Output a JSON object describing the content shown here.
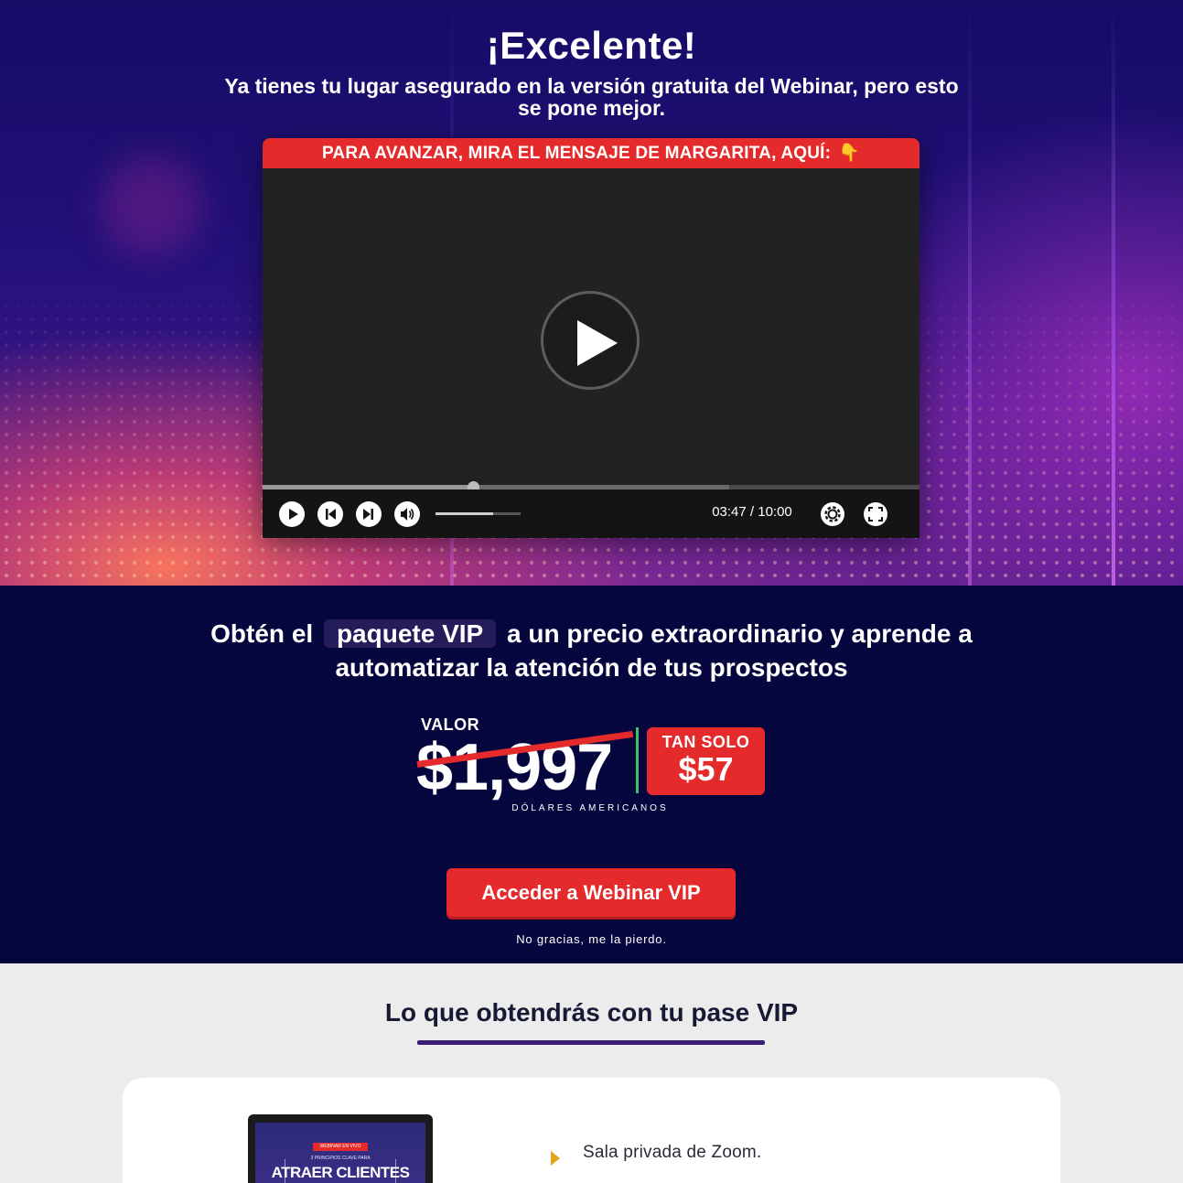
{
  "hero": {
    "title": "¡Excelente!",
    "subtitle": "Ya tienes tu lugar asegurado en la versión gratuita del Webinar, pero esto se pone mejor."
  },
  "video": {
    "banner_text": "PARA AVANZAR, MIRA EL MENSAJE DE MARGARITA, AQUÍ:",
    "banner_emoji": "👇",
    "time_display": "03:47 / 10:00",
    "progress_played": 0.32,
    "progress_buffered": 0.71,
    "volume_level": 0.68,
    "icons": [
      "play-icon",
      "skip-back-icon",
      "skip-forward-icon",
      "volume-icon",
      "settings-gear-icon",
      "fullscreen-icon"
    ]
  },
  "offer": {
    "headline_before": "Obtén el",
    "headline_highlight": "paquete VIP",
    "headline_after": "a un precio extraordinario y aprende a automatizar la atención de tus prospectos",
    "valor_label": "VALOR",
    "old_price": "$1,997",
    "tan_solo_label": "TAN SOLO",
    "new_price": "$57",
    "currency_note": "DÓLARES AMERICANOS",
    "cta_label": "Acceder a Webinar VIP",
    "decline_label": "No gracias, me la pierdo."
  },
  "benefits": {
    "title": "Lo que obtendrás con tu pase VIP",
    "laptop_screen": {
      "tag": "WEBINAR EN VIVO",
      "small": "3 PRINCIPIOS CLAVE PARA",
      "big": "ATRAER CLIENTES"
    },
    "items": [
      {
        "label": "Sala privada de Zoom."
      }
    ]
  },
  "colors": {
    "accent_red": "#e42a2a",
    "offer_bg": "#05063d",
    "underline_purple": "#3a1f7a",
    "bullet_orange": "#e6a21a",
    "divider_green": "#3bc46a"
  }
}
